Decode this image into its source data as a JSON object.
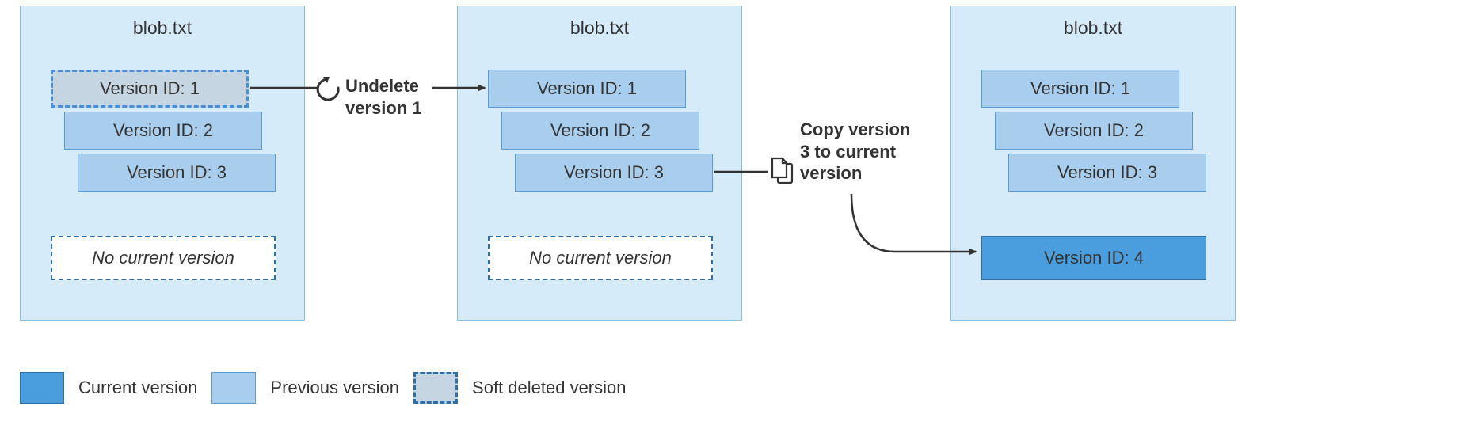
{
  "panels": {
    "a": {
      "title": "blob.txt"
    },
    "b": {
      "title": "blob.txt"
    },
    "c": {
      "title": "blob.txt"
    }
  },
  "versions": {
    "v1": "Version ID: 1",
    "v2": "Version ID: 2",
    "v3": "Version ID: 3",
    "v4": "Version ID: 4"
  },
  "no_current": "No current version",
  "actions": {
    "undelete_l1": "Undelete",
    "undelete_l2": "version 1",
    "copy_l1": "Copy version",
    "copy_l2": "3 to current",
    "copy_l3": "version"
  },
  "legend": {
    "current": "Current version",
    "previous": "Previous version",
    "softdel": "Soft deleted version"
  }
}
